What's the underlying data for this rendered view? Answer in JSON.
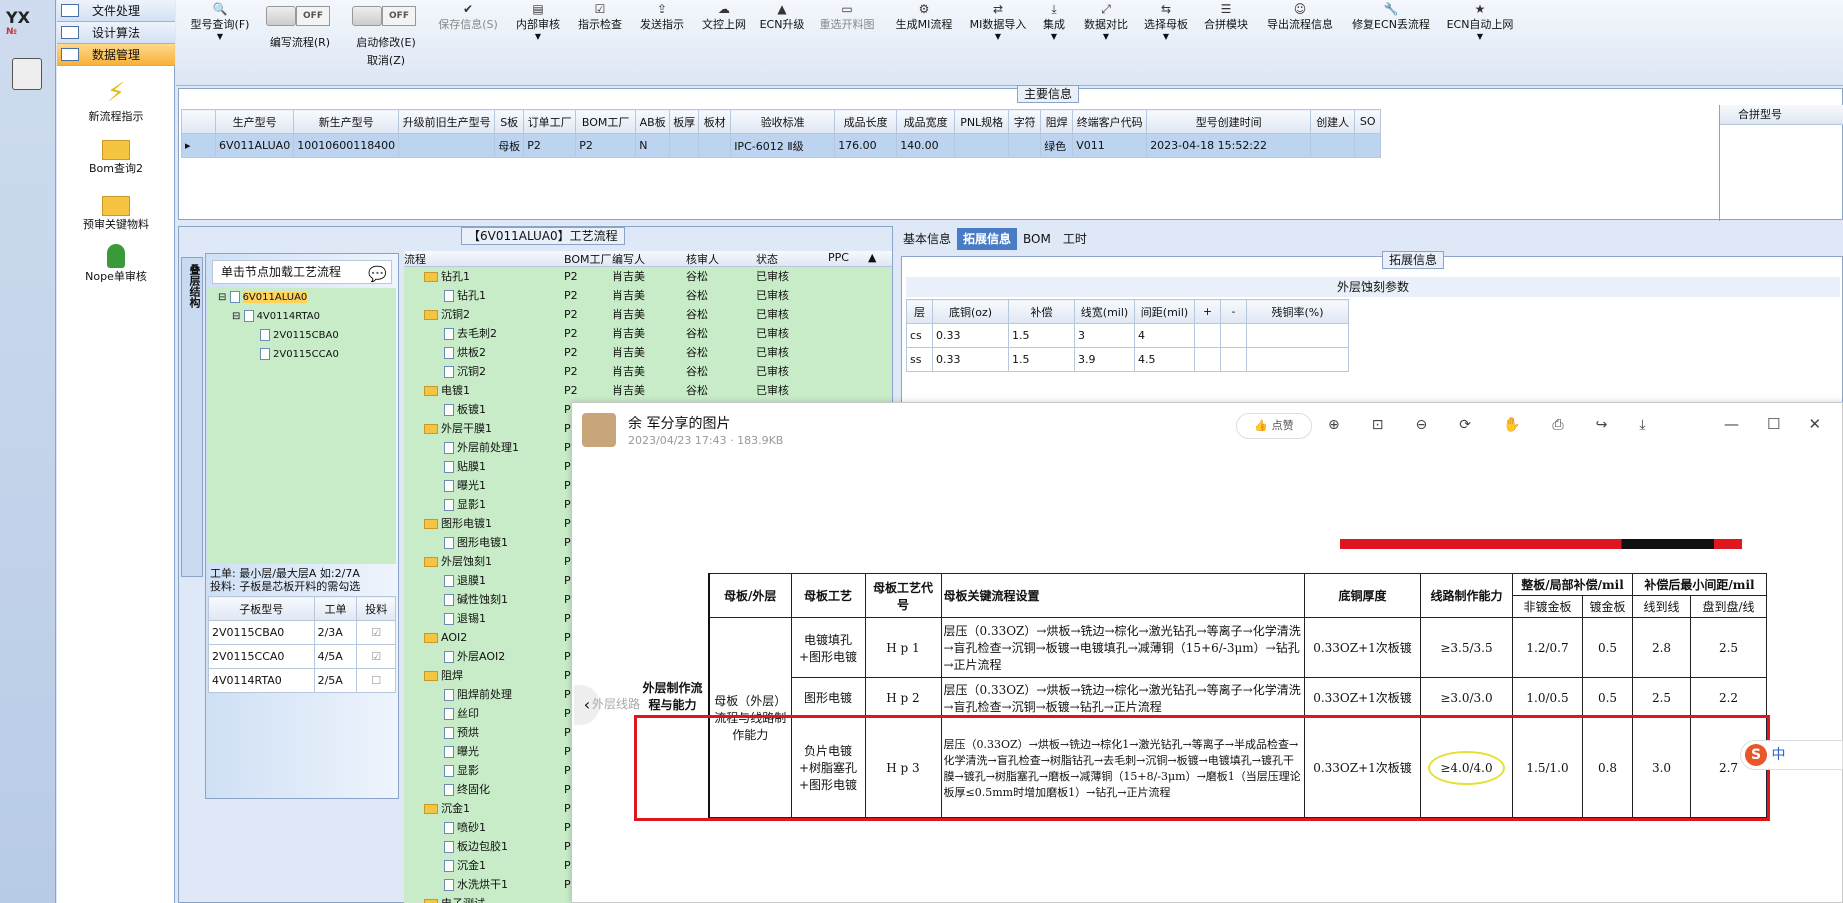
{
  "logo": {
    "text": "YX",
    "sub": "№"
  },
  "nav": {
    "items": [
      {
        "label": "文件处理"
      },
      {
        "label": "设计算法"
      },
      {
        "label": "数据管理"
      }
    ],
    "shortcuts": [
      {
        "label": "新流程指示"
      },
      {
        "label": "Bom查询2"
      },
      {
        "label": "预审关键物料"
      },
      {
        "label": "Nope单审核"
      }
    ]
  },
  "toolbar": {
    "model_query": "型号查询(F)",
    "edit_flow": "编写流程(R)",
    "enable_edit": "启动修改(E)",
    "cancel": "取消(Z)",
    "off": "OFF",
    "save_info": "保存信息(S)",
    "internal_review": "内部审核",
    "check_instructions": "指示检查",
    "send_instructions": "发送指示",
    "upload_doc": "文控上网",
    "ecn_upgrade": "ECN升级",
    "reopen_drawing": "重选开料图",
    "gen_mi": "生成MI流程",
    "mi_import": "MI数据导入",
    "collect": "集成",
    "compare": "数据对比",
    "select_mother": "选择母板",
    "merge_module": "合拼模块",
    "export_info": "导出流程信息",
    "fix_ecn": "修复ECN丢流程",
    "ecn_auto": "ECN自动上网"
  },
  "main_info": {
    "title": "主要信息",
    "headers": [
      "生产型号",
      "新生产型号",
      "升级前旧生产型号",
      "S板",
      "订单工厂",
      "BOM工厂",
      "AB板",
      "板厚",
      "板材",
      "验收标准",
      "成品长度",
      "成品宽度",
      "PNL规格",
      "字符",
      "阻焊",
      "终端客户代码",
      "型号创建时间",
      "创建人",
      "SO"
    ],
    "row": [
      "6V011ALUA0",
      "10010600118400",
      "",
      "母板",
      "P2",
      "P2",
      "N",
      "",
      "",
      "IPC-6012 Ⅱ级",
      "176.00",
      "140.00",
      "",
      "",
      "绿色",
      "V011",
      "2023-04-18 15:52:22",
      "",
      ""
    ],
    "merge_header": "合拼型号"
  },
  "process": {
    "title": "【6V011ALUA0】工艺流程",
    "side_tab": "叠层结构",
    "hint": "单击节点加载工艺流程",
    "tree": [
      "6V011ALUA0",
      "4V0114RTA0",
      "2V0115CBA0",
      "2V0115CCA0"
    ],
    "work_note": "工单: 最小层/最大层A 如:2/7A",
    "feed_note": "投料: 子板是芯板开料的需勾选",
    "sub_headers": [
      "子板型号",
      "工单",
      "投料"
    ],
    "sub_rows": [
      [
        "2V0115CBA0",
        "2/3A"
      ],
      [
        "2V0115CCA0",
        "4/5A"
      ],
      [
        "4V0114RTA0",
        "2/5A"
      ]
    ],
    "flow_headers": [
      "流程",
      "BOM工厂",
      "编写人",
      "核审人",
      "状态",
      "PPC"
    ],
    "flow_rows": [
      {
        "name": "钻孔1",
        "lvl": 0,
        "f": "P2",
        "w": "肖吉美",
        "r": "谷松",
        "s": "已审核"
      },
      {
        "name": "钻孔1",
        "lvl": 1,
        "f": "P2",
        "w": "肖吉美",
        "r": "谷松",
        "s": "已审核"
      },
      {
        "name": "沉铜2",
        "lvl": 0,
        "f": "P2",
        "w": "肖吉美",
        "r": "谷松",
        "s": "已审核"
      },
      {
        "name": "去毛刺2",
        "lvl": 1,
        "f": "P2",
        "w": "肖吉美",
        "r": "谷松",
        "s": "已审核"
      },
      {
        "name": "烘板2",
        "lvl": 1,
        "f": "P2",
        "w": "肖吉美",
        "r": "谷松",
        "s": "已审核"
      },
      {
        "name": "沉铜2",
        "lvl": 1,
        "f": "P2",
        "w": "肖吉美",
        "r": "谷松",
        "s": "已审核"
      },
      {
        "name": "电镀1",
        "lvl": 0,
        "f": "P2",
        "w": "肖吉美",
        "r": "谷松",
        "s": "已审核"
      },
      {
        "name": "板镀1",
        "lvl": 1,
        "f": "P2",
        "w": "肖吉美",
        "r": "谷松",
        "s": "已审核"
      },
      {
        "name": "外层干膜1",
        "lvl": 0,
        "f": "P",
        "w": "",
        "r": "",
        "s": ""
      },
      {
        "name": "外层前处理1",
        "lvl": 1,
        "f": "P",
        "w": "",
        "r": "",
        "s": ""
      },
      {
        "name": "贴膜1",
        "lvl": 1,
        "f": "P",
        "w": "",
        "r": "",
        "s": ""
      },
      {
        "name": "曝光1",
        "lvl": 1,
        "f": "P",
        "w": "",
        "r": "",
        "s": ""
      },
      {
        "name": "显影1",
        "lvl": 1,
        "f": "P",
        "w": "",
        "r": "",
        "s": ""
      },
      {
        "name": "图形电镀1",
        "lvl": 0,
        "f": "P",
        "w": "",
        "r": "",
        "s": ""
      },
      {
        "name": "图形电镀1",
        "lvl": 1,
        "f": "P",
        "w": "",
        "r": "",
        "s": ""
      },
      {
        "name": "外层蚀刻1",
        "lvl": 0,
        "f": "P",
        "w": "",
        "r": "",
        "s": ""
      },
      {
        "name": "退膜1",
        "lvl": 1,
        "f": "P",
        "w": "",
        "r": "",
        "s": ""
      },
      {
        "name": "碱性蚀刻1",
        "lvl": 1,
        "f": "P",
        "w": "",
        "r": "",
        "s": ""
      },
      {
        "name": "退锡1",
        "lvl": 1,
        "f": "P",
        "w": "",
        "r": "",
        "s": ""
      },
      {
        "name": "AOI2",
        "lvl": 0,
        "f": "P",
        "w": "",
        "r": "",
        "s": ""
      },
      {
        "name": "外层AOI2",
        "lvl": 1,
        "f": "P",
        "w": "",
        "r": "",
        "s": ""
      },
      {
        "name": "阻焊",
        "lvl": 0,
        "f": "P",
        "w": "",
        "r": "",
        "s": ""
      },
      {
        "name": "阻焊前处理",
        "lvl": 1,
        "f": "P",
        "w": "",
        "r": "",
        "s": ""
      },
      {
        "name": "丝印",
        "lvl": 1,
        "f": "P",
        "w": "",
        "r": "",
        "s": ""
      },
      {
        "name": "预烘",
        "lvl": 1,
        "f": "P",
        "w": "",
        "r": "",
        "s": ""
      },
      {
        "name": "曝光",
        "lvl": 1,
        "f": "P",
        "w": "",
        "r": "",
        "s": ""
      },
      {
        "name": "显影",
        "lvl": 1,
        "f": "P",
        "w": "",
        "r": "",
        "s": ""
      },
      {
        "name": "终固化",
        "lvl": 1,
        "f": "P",
        "w": "",
        "r": "",
        "s": ""
      },
      {
        "name": "沉金1",
        "lvl": 0,
        "f": "P",
        "w": "",
        "r": "",
        "s": ""
      },
      {
        "name": "喷砂1",
        "lvl": 1,
        "f": "P",
        "w": "",
        "r": "",
        "s": ""
      },
      {
        "name": "板边包胶1",
        "lvl": 1,
        "f": "P",
        "w": "",
        "r": "",
        "s": ""
      },
      {
        "name": "沉金1",
        "lvl": 1,
        "f": "P",
        "w": "",
        "r": "",
        "s": ""
      },
      {
        "name": "水洗烘干1",
        "lvl": 1,
        "f": "P",
        "w": "",
        "r": "",
        "s": ""
      },
      {
        "name": "电子测试",
        "lvl": 0,
        "f": "",
        "w": "",
        "r": "",
        "s": ""
      }
    ]
  },
  "right": {
    "tabs": [
      "基本信息",
      "拓展信息",
      "BOM",
      "工时"
    ],
    "sub_title": "拓展信息",
    "etch_title": "外层蚀刻参数",
    "etch_headers": [
      "层",
      "底铜(oz)",
      "补偿",
      "线宽(mil)",
      "间距(mil)",
      "+",
      "-",
      "残铜率(%)"
    ],
    "etch_rows": [
      [
        "cs",
        "0.33",
        "1.5",
        "3",
        "4"
      ],
      [
        "ss",
        "0.33",
        "1.5",
        "3.9",
        "4.5"
      ]
    ]
  },
  "viewer": {
    "title": "余 军分享的图片",
    "meta": "2023/04/23 17:43 · 183.9KB",
    "like": "点赞",
    "side_text": "外层线路",
    "doc": {
      "h_outer": "母板/外层",
      "h_proc": "母板工艺",
      "h_code": "母板工艺代号",
      "h_flow": "母板关键流程设置",
      "h_cu": "底铜厚度",
      "h_cap": "线路制作能力",
      "h_comp": "整板/局部补偿/mil",
      "h_comp1": "非镀金板",
      "h_comp2": "镀金板",
      "h_min": "补偿后最小间距/mil",
      "h_min1": "线到线",
      "h_min2": "盘到盘/线",
      "left_label": "外层制作流程与能力",
      "mid_label": "母板（外层）流程与线路制作能力",
      "rows": [
        {
          "proc": "电镀填孔+图形电镀",
          "code": "H p 1",
          "flow": "层压（0.33OZ）→烘板→铣边→棕化→激光钻孔→等离子→化学清洗→盲孔检查→沉铜→板镀→电镀填孔→减薄铜（15+6/-3μm）→钻孔→正片流程",
          "cu": "0.33OZ+1次板镀",
          "cap": "≥3.5/3.5",
          "c1": "1.2/0.7",
          "c2": "0.5",
          "m1": "2.8",
          "m2": "2.5"
        },
        {
          "proc": "图形电镀",
          "code": "H p 2",
          "flow": "层压（0.33OZ）→烘板→铣边→棕化→激光钻孔→等离子→化学清洗→盲孔检查→沉铜→板镀→钻孔→正片流程",
          "cu": "0.33OZ+1次板镀",
          "cap": "≥3.0/3.0",
          "c1": "1.0/0.5",
          "c2": "0.5",
          "m1": "2.5",
          "m2": "2.2"
        },
        {
          "proc": "负片电镀+树脂塞孔+图形电镀",
          "code": "H p 3",
          "flow": "层压（0.33OZ）→烘板→铣边→棕化1→激光钻孔→等离子→半成品检查→化学清洗→盲孔检查→树脂钻孔→去毛刺→沉铜→板镀→电镀填孔→镀孔干膜→镀孔→树脂塞孔→磨板→减薄铜（15+8/-3μm）→磨板1（当层压理论板厚≤0.5mm时增加磨板1）→钻孔→正片流程",
          "cu": "0.33OZ+1次板镀",
          "cap": "≥4.0/4.0",
          "c1": "1.5/1.0",
          "c2": "0.8",
          "m1": "3.0",
          "m2": "2.7"
        }
      ]
    }
  },
  "ime": {
    "label": "中"
  }
}
